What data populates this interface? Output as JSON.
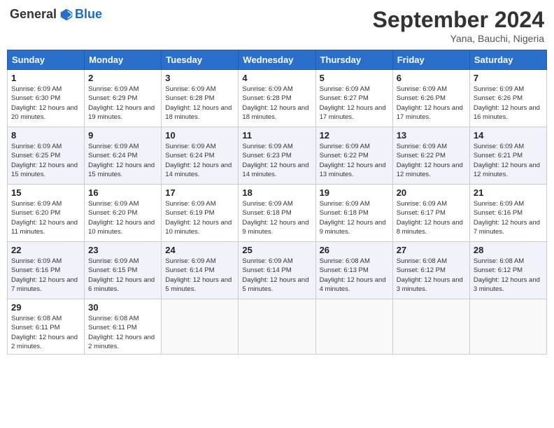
{
  "header": {
    "logo_general": "General",
    "logo_blue": "Blue",
    "month_title": "September 2024",
    "subtitle": "Yana, Bauchi, Nigeria"
  },
  "days_of_week": [
    "Sunday",
    "Monday",
    "Tuesday",
    "Wednesday",
    "Thursday",
    "Friday",
    "Saturday"
  ],
  "weeks": [
    [
      {
        "day": "1",
        "sunrise": "6:09 AM",
        "sunset": "6:30 PM",
        "daylight": "12 hours and 20 minutes."
      },
      {
        "day": "2",
        "sunrise": "6:09 AM",
        "sunset": "6:29 PM",
        "daylight": "12 hours and 19 minutes."
      },
      {
        "day": "3",
        "sunrise": "6:09 AM",
        "sunset": "6:28 PM",
        "daylight": "12 hours and 18 minutes."
      },
      {
        "day": "4",
        "sunrise": "6:09 AM",
        "sunset": "6:28 PM",
        "daylight": "12 hours and 18 minutes."
      },
      {
        "day": "5",
        "sunrise": "6:09 AM",
        "sunset": "6:27 PM",
        "daylight": "12 hours and 17 minutes."
      },
      {
        "day": "6",
        "sunrise": "6:09 AM",
        "sunset": "6:26 PM",
        "daylight": "12 hours and 17 minutes."
      },
      {
        "day": "7",
        "sunrise": "6:09 AM",
        "sunset": "6:26 PM",
        "daylight": "12 hours and 16 minutes."
      }
    ],
    [
      {
        "day": "8",
        "sunrise": "6:09 AM",
        "sunset": "6:25 PM",
        "daylight": "12 hours and 15 minutes."
      },
      {
        "day": "9",
        "sunrise": "6:09 AM",
        "sunset": "6:24 PM",
        "daylight": "12 hours and 15 minutes."
      },
      {
        "day": "10",
        "sunrise": "6:09 AM",
        "sunset": "6:24 PM",
        "daylight": "12 hours and 14 minutes."
      },
      {
        "day": "11",
        "sunrise": "6:09 AM",
        "sunset": "6:23 PM",
        "daylight": "12 hours and 14 minutes."
      },
      {
        "day": "12",
        "sunrise": "6:09 AM",
        "sunset": "6:22 PM",
        "daylight": "12 hours and 13 minutes."
      },
      {
        "day": "13",
        "sunrise": "6:09 AM",
        "sunset": "6:22 PM",
        "daylight": "12 hours and 12 minutes."
      },
      {
        "day": "14",
        "sunrise": "6:09 AM",
        "sunset": "6:21 PM",
        "daylight": "12 hours and 12 minutes."
      }
    ],
    [
      {
        "day": "15",
        "sunrise": "6:09 AM",
        "sunset": "6:20 PM",
        "daylight": "12 hours and 11 minutes."
      },
      {
        "day": "16",
        "sunrise": "6:09 AM",
        "sunset": "6:20 PM",
        "daylight": "12 hours and 10 minutes."
      },
      {
        "day": "17",
        "sunrise": "6:09 AM",
        "sunset": "6:19 PM",
        "daylight": "12 hours and 10 minutes."
      },
      {
        "day": "18",
        "sunrise": "6:09 AM",
        "sunset": "6:18 PM",
        "daylight": "12 hours and 9 minutes."
      },
      {
        "day": "19",
        "sunrise": "6:09 AM",
        "sunset": "6:18 PM",
        "daylight": "12 hours and 9 minutes."
      },
      {
        "day": "20",
        "sunrise": "6:09 AM",
        "sunset": "6:17 PM",
        "daylight": "12 hours and 8 minutes."
      },
      {
        "day": "21",
        "sunrise": "6:09 AM",
        "sunset": "6:16 PM",
        "daylight": "12 hours and 7 minutes."
      }
    ],
    [
      {
        "day": "22",
        "sunrise": "6:09 AM",
        "sunset": "6:16 PM",
        "daylight": "12 hours and 7 minutes."
      },
      {
        "day": "23",
        "sunrise": "6:09 AM",
        "sunset": "6:15 PM",
        "daylight": "12 hours and 6 minutes."
      },
      {
        "day": "24",
        "sunrise": "6:09 AM",
        "sunset": "6:14 PM",
        "daylight": "12 hours and 5 minutes."
      },
      {
        "day": "25",
        "sunrise": "6:09 AM",
        "sunset": "6:14 PM",
        "daylight": "12 hours and 5 minutes."
      },
      {
        "day": "26",
        "sunrise": "6:08 AM",
        "sunset": "6:13 PM",
        "daylight": "12 hours and 4 minutes."
      },
      {
        "day": "27",
        "sunrise": "6:08 AM",
        "sunset": "6:12 PM",
        "daylight": "12 hours and 3 minutes."
      },
      {
        "day": "28",
        "sunrise": "6:08 AM",
        "sunset": "6:12 PM",
        "daylight": "12 hours and 3 minutes."
      }
    ],
    [
      {
        "day": "29",
        "sunrise": "6:08 AM",
        "sunset": "6:11 PM",
        "daylight": "12 hours and 2 minutes."
      },
      {
        "day": "30",
        "sunrise": "6:08 AM",
        "sunset": "6:11 PM",
        "daylight": "12 hours and 2 minutes."
      },
      null,
      null,
      null,
      null,
      null
    ]
  ]
}
